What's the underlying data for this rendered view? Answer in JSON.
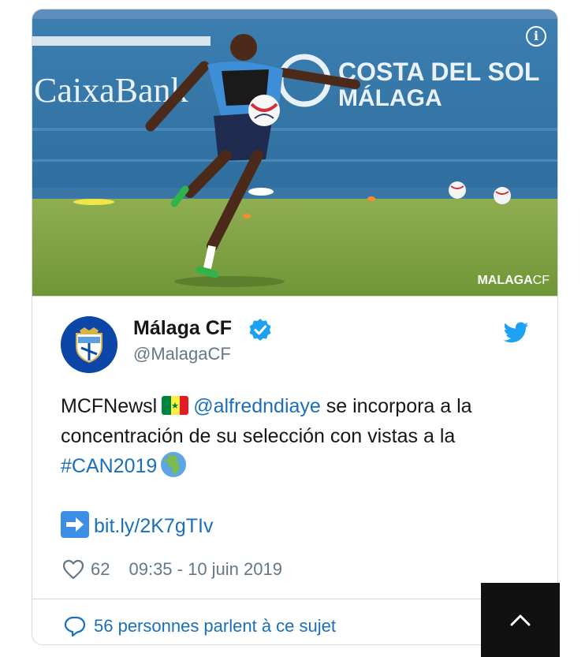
{
  "media": {
    "watermark_bold": "MALAGA",
    "watermark_light": "CF",
    "info_icon": "info-icon",
    "banner_left": "CaixaBank",
    "banner_right_top": "COSTA DEL SOL",
    "banner_right_bottom": "MÁLAGA"
  },
  "author": {
    "name": "Málaga CF",
    "handle": "@MalagaCF",
    "verified_icon": "verified-badge-icon"
  },
  "platform_icon": "twitter-bird-icon",
  "tweet": {
    "prefix": "MCFNewsl",
    "flag_icon": "senegal-flag-icon",
    "mention": "@alfredndiaye",
    "text_after_mention": " se incorpora a la concentración de su selección con vistas a la ",
    "hashtag": "#CAN2019",
    "globe_icon": "globe-africa-icon",
    "arrow_icon": "right-arrow-icon",
    "link": "bit.ly/2K7gTIv"
  },
  "meta": {
    "likes": "62",
    "timestamp": "09:35 - 10 juin 2019"
  },
  "footer": {
    "conversation": "56 personnes parlent à ce sujet"
  },
  "colors": {
    "link": "#1b6fb8",
    "text": "#14171a",
    "muted": "#657786",
    "twitter_blue": "#1da1f2"
  }
}
